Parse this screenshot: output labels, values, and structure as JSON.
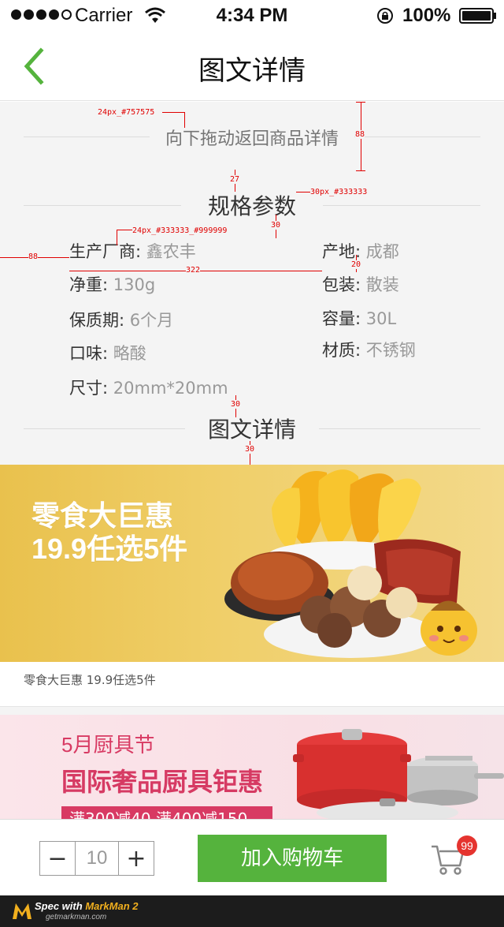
{
  "status_bar": {
    "carrier": "Carrier",
    "time": "4:34 PM",
    "battery": "100%"
  },
  "nav": {
    "title": "图文详情"
  },
  "pull_hint": "向下拖动返回商品详情",
  "spec_section_title": "规格参数",
  "specs_left": [
    {
      "key": "生产厂商:",
      "value": "鑫农丰"
    },
    {
      "key": "净重:",
      "value": "130g"
    },
    {
      "key": "保质期:",
      "value": "6个月"
    },
    {
      "key": "口味:",
      "value": "略酸"
    },
    {
      "key": "尺寸:",
      "value": "20mm*20mm"
    }
  ],
  "specs_right": [
    {
      "key": "产地:",
      "value": "成都"
    },
    {
      "key": "包装:",
      "value": "散装"
    },
    {
      "key": "容量:",
      "value": "30L"
    },
    {
      "key": "材质:",
      "value": "不锈钢"
    }
  ],
  "detail_section_title": "图文详情",
  "annotations": {
    "hint_font": "24px_#757575",
    "title_font": "30px_#333333",
    "spec_font": "24px_#333333_#999999",
    "d88_top": "88",
    "d27": "27",
    "d30_a": "30",
    "d88_left": "88",
    "d322": "322",
    "d20": "20",
    "d30_b": "30",
    "d30_c": "30"
  },
  "banner1": {
    "line1": "零食大巨惠",
    "line2": "19.9任选5件",
    "caption": "零食大巨惠 19.9任选5件"
  },
  "banner2": {
    "line1": "5月厨具节",
    "line2": "国际奢品厨具钜惠",
    "ribbon": "满300减40 满400减150"
  },
  "bottom_bar": {
    "quantity": "10",
    "minus": "−",
    "plus": "+",
    "add_to_cart": "加入购物车",
    "cart_badge": "99"
  },
  "footer": {
    "spec_with": "Spec with",
    "markman": "MarkMan 2",
    "site": "getmarkman.com"
  },
  "colors": {
    "accent_green": "#55b33d",
    "hint_gray": "#757575",
    "text_dark": "#333333",
    "value_gray": "#999999",
    "badge_red": "#e5342f",
    "annotation_red": "#e00000"
  }
}
